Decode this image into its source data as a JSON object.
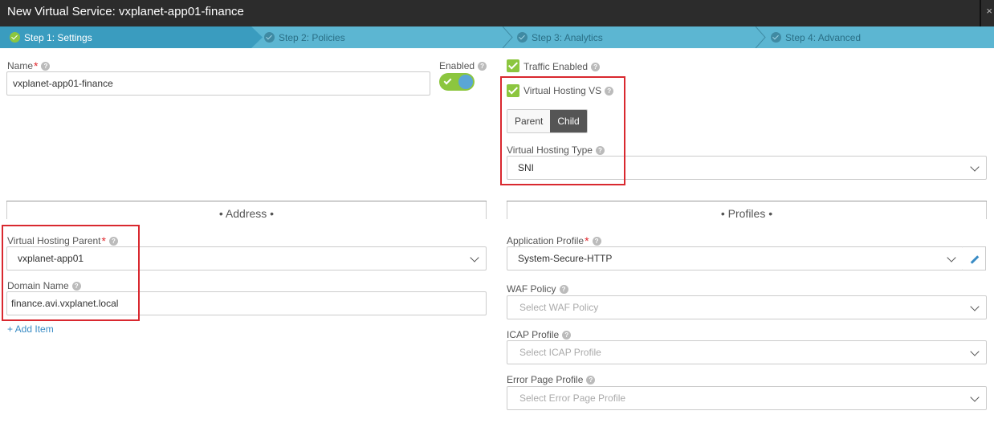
{
  "window": {
    "title": "New Virtual Service: vxplanet-app01-finance",
    "close_glyph": "×"
  },
  "steps": [
    {
      "label": "Step 1: Settings",
      "active": true
    },
    {
      "label": "Step 2: Policies",
      "active": false
    },
    {
      "label": "Step 3: Analytics",
      "active": false
    },
    {
      "label": "Step 4: Advanced",
      "active": false
    }
  ],
  "colors": {
    "accent_green": "#8cc63f",
    "steps_bar": "#5cb6d2",
    "active_step": "#3a9cbf",
    "highlight_red": "#d9282f",
    "link_blue": "#3a8cc5"
  },
  "icons": {
    "help": "question-circle-icon",
    "check": "check-icon",
    "chevron": "chevron-down-icon",
    "edit": "pencil-icon"
  },
  "help_glyph": "?",
  "required_mark": "*",
  "name": {
    "label": "Name",
    "value": "vxplanet-app01-finance"
  },
  "enabled": {
    "label": "Enabled",
    "on": true
  },
  "traffic_enabled": {
    "label": "Traffic Enabled",
    "checked": true
  },
  "virtual_hosting_vs": {
    "label": "Virtual Hosting VS",
    "checked": true
  },
  "hosting_mode": {
    "options": [
      "Parent",
      "Child"
    ],
    "selected": "Child"
  },
  "virtual_hosting_type": {
    "label": "Virtual Hosting Type",
    "value": "SNI"
  },
  "sections": {
    "address": "• Address •",
    "profiles": "• Profiles •"
  },
  "virtual_hosting_parent": {
    "label": "Virtual Hosting Parent",
    "value": "vxplanet-app01"
  },
  "domain_name": {
    "label": "Domain Name",
    "value": "finance.avi.vxplanet.local"
  },
  "add_item": "+ Add Item",
  "application_profile": {
    "label": "Application Profile",
    "value": "System-Secure-HTTP"
  },
  "waf_policy": {
    "label": "WAF Policy",
    "placeholder": "Select WAF Policy"
  },
  "icap_profile": {
    "label": "ICAP Profile",
    "placeholder": "Select ICAP Profile"
  },
  "error_page_profile": {
    "label": "Error Page Profile",
    "placeholder": "Select Error Page Profile"
  }
}
